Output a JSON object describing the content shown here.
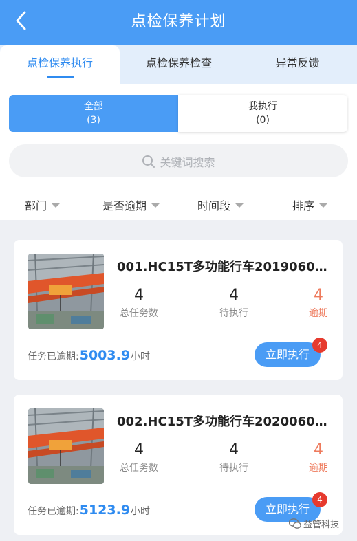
{
  "header": {
    "title": "点检保养计划",
    "back_icon": "chevron-left-icon"
  },
  "tabs": [
    {
      "label": "点检保养执行",
      "active": true
    },
    {
      "label": "点检保养检查",
      "active": false
    },
    {
      "label": "异常反馈",
      "active": false
    }
  ],
  "segments": [
    {
      "label": "全部",
      "count": "(3)",
      "active": true
    },
    {
      "label": "我执行",
      "count": "(0)",
      "active": false
    }
  ],
  "search": {
    "placeholder": "关键词搜索",
    "icon": "search-icon"
  },
  "filters": [
    {
      "label": "部门"
    },
    {
      "label": "是否逾期"
    },
    {
      "label": "时间段"
    },
    {
      "label": "排序"
    }
  ],
  "colors": {
    "primary": "#4a9cf5",
    "accent_text": "#2f8bf0",
    "overdue": "#ee7a5c",
    "badge": "#e63a2e"
  },
  "cards": [
    {
      "title": "001.HC15T多功能行车2019060…",
      "stats": [
        {
          "value": "4",
          "label": "总任务数"
        },
        {
          "value": "4",
          "label": "待执行"
        },
        {
          "value": "4",
          "label": "逾期"
        }
      ],
      "overdue_prefix": "任务已逾期:",
      "overdue_value": "5003.9",
      "overdue_unit": "小时",
      "button_label": "立即执行",
      "badge": "4"
    },
    {
      "title": "002.HC15T多功能行车2020060…",
      "stats": [
        {
          "value": "4",
          "label": "总任务数"
        },
        {
          "value": "4",
          "label": "待执行"
        },
        {
          "value": "4",
          "label": "逾期"
        }
      ],
      "overdue_prefix": "任务已逾期:",
      "overdue_value": "5123.9",
      "overdue_unit": "小时",
      "button_label": "立即执行",
      "badge": "4"
    }
  ],
  "watermark": {
    "text": "益管科技",
    "icon": "wechat-icon"
  }
}
